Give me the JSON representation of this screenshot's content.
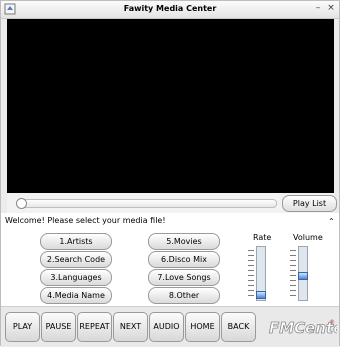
{
  "window": {
    "title": "Fawity Media Center"
  },
  "controls": {
    "playlist_label": "Play List"
  },
  "panel": {
    "welcome": "Welcome!  Please select your media file!",
    "buttons_left": [
      "1.Artists",
      "2.Search Code",
      "3.Languages",
      "4.Media Name"
    ],
    "buttons_right": [
      "5.Movies",
      "6.Disco Mix",
      "7.Love Songs",
      "8.Other"
    ],
    "rate": {
      "label": "Rate",
      "level": 0.02
    },
    "volume": {
      "label": "Volume",
      "level": 0.45
    }
  },
  "nav": [
    "PLAY",
    "PAUSE",
    "REPEAT",
    "NEXT",
    "AUDIO",
    "HOME",
    "BACK"
  ],
  "seek": {
    "position": 0
  },
  "logo": {
    "text": "FMCenter"
  }
}
